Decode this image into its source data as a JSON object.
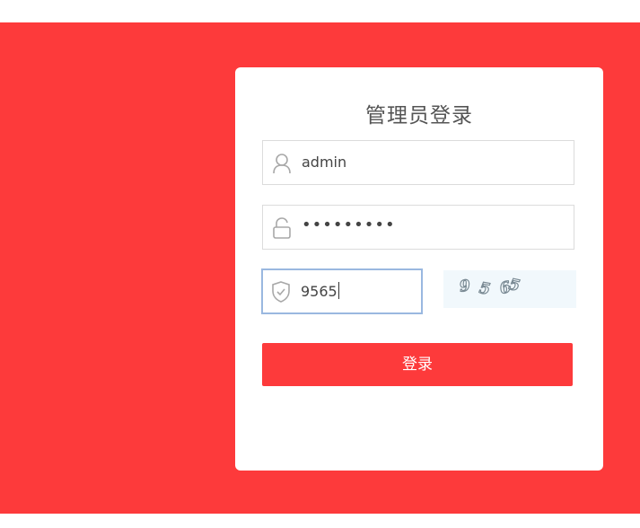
{
  "login": {
    "title": "管理员登录",
    "username": {
      "value": "admin",
      "icon": "user-icon"
    },
    "password": {
      "value": "•••••••••",
      "icon": "lock-icon"
    },
    "captcha_input": {
      "value": "9565",
      "icon": "shield-check-icon"
    },
    "captcha_image": {
      "digits": [
        "9",
        "5",
        "6",
        "5"
      ]
    },
    "submit_label": "登录"
  },
  "colors": {
    "background": "#fd3a3b",
    "button": "#fd3a3b",
    "focus_border": "#9ab8e0",
    "captcha_bg": "#f1f8fc"
  }
}
